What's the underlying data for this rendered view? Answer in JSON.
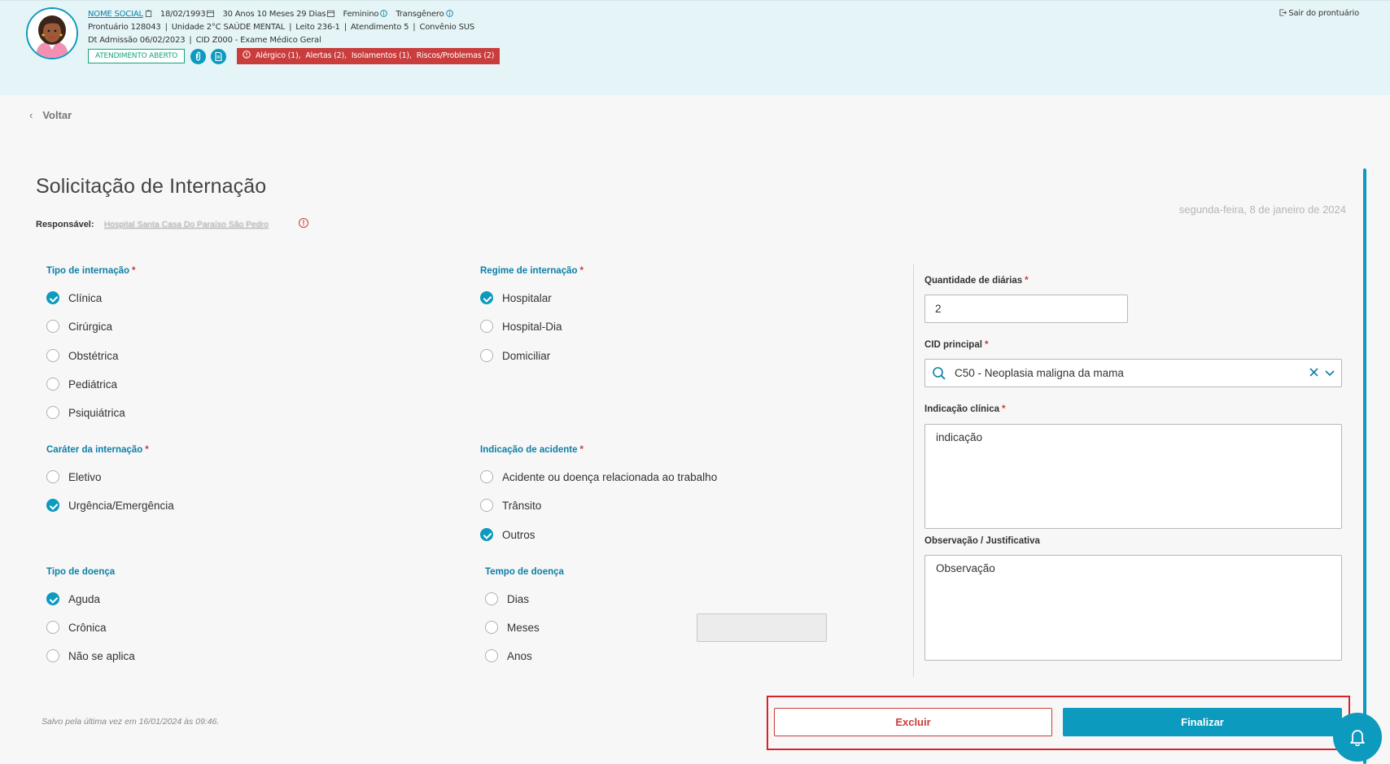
{
  "patient": {
    "social_name": "NOME SOCIAL",
    "birthdate": "18/02/1993",
    "age": "30 Anos 10 Meses 29 Dias",
    "gender": "Feminino",
    "identity": "Transgênero",
    "prontuario": "Prontuário 128043",
    "unidade": "Unidade 2°C SAÚDE MENTAL",
    "leito": "Leito 236-1",
    "atendimento": "Atendimento 5",
    "convenio": "Convênio SUS",
    "admissao": "Dt Admissão 06/02/2023",
    "cid": "CID Z000 - Exame Médico Geral",
    "status_badge": "ATENDIMENTO ABERTO",
    "alerts": [
      "Alérgico (1),",
      "Alertas (2),",
      "Isolamentos (1),",
      "Riscos/Problemas (2)"
    ],
    "exit_label": "Sair do prontuário"
  },
  "nav": {
    "back_label": "Voltar"
  },
  "form": {
    "title": "Solicitação de Internação",
    "date": "segunda-feira, 8 de janeiro de 2024",
    "responsavel_label": "Responsável:",
    "responsavel_value": "Hospital Santa Casa Do Paraíso São Pedro",
    "tipo_internacao": {
      "label": "Tipo de internação",
      "options": [
        "Clínica",
        "Cirúrgica",
        "Obstétrica",
        "Pediátrica",
        "Psiquiátrica"
      ],
      "selected": "Clínica"
    },
    "regime_internacao": {
      "label": "Regime de internação",
      "options": [
        "Hospitalar",
        "Hospital-Dia",
        "Domiciliar"
      ],
      "selected": "Hospitalar"
    },
    "carater_internacao": {
      "label": "Caráter da internação",
      "options": [
        "Eletivo",
        "Urgência/Emergência"
      ],
      "selected": "Urgência/Emergência"
    },
    "indicacao_acidente": {
      "label": "Indicação de acidente",
      "options": [
        "Acidente ou doença relacionada ao trabalho",
        "Trânsito",
        "Outros"
      ],
      "selected": "Outros"
    },
    "tipo_doenca": {
      "label": "Tipo de doença",
      "options": [
        "Aguda",
        "Crônica",
        "Não se aplica"
      ],
      "selected": "Aguda"
    },
    "tempo_doenca": {
      "label": "Tempo de doença",
      "options": [
        "Dias",
        "Meses",
        "Anos"
      ],
      "selected": ""
    },
    "quantidade_diarias": {
      "label": "Quantidade de diárias",
      "value": "2"
    },
    "cid_principal": {
      "label": "CID principal",
      "value": "C50 - Neoplasia maligna da mama"
    },
    "indicacao_clinica": {
      "label": "Indicação clínica",
      "value": "indicação"
    },
    "observacao": {
      "label": "Observação / Justificativa",
      "value": "Observação"
    },
    "saved_text": "Salvo pela última vez em 16/01/2024 às 09:46.",
    "delete_label": "Excluir",
    "finish_label": "Finalizar"
  },
  "colors": {
    "primary": "#0c9abe",
    "danger": "#c93d3d",
    "header_bg": "#e5f5f7"
  }
}
